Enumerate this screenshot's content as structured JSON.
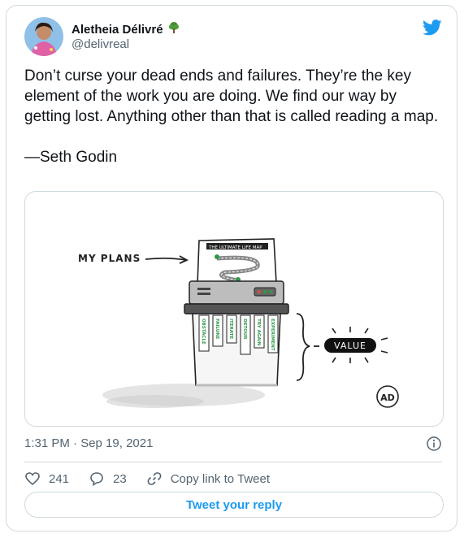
{
  "author": {
    "name": "Aletheia Délivré",
    "handle": "@delivreal",
    "emoji_icon": "tree-icon"
  },
  "tweet": {
    "body": "Don’t curse your dead ends and failures. They’re the key element of the work you are doing. We find our way by getting lost. Anything other than that is called reading a map.",
    "attribution": "—Seth Godin"
  },
  "media": {
    "label_plans": "MY PLANS",
    "paper_title": "THE ULTIMATE LIFE MAP",
    "strips": [
      "OBSTACLE",
      "FAILURE",
      "ITERATE",
      "DETOUR",
      "TRY AGAIN",
      "EXPERIMENT"
    ],
    "value_label": "VALUE",
    "signature": "AD"
  },
  "meta": {
    "timestamp": "1:31 PM · Sep 19, 2021"
  },
  "actions": {
    "likes": "241",
    "replies": "23",
    "copy_link": "Copy link to Tweet"
  },
  "reply_button": "Tweet your reply",
  "colors": {
    "accent": "#1d9bf0",
    "text_secondary": "#536471",
    "border": "#cfd9de",
    "strip_green": "#2e9a4a"
  }
}
